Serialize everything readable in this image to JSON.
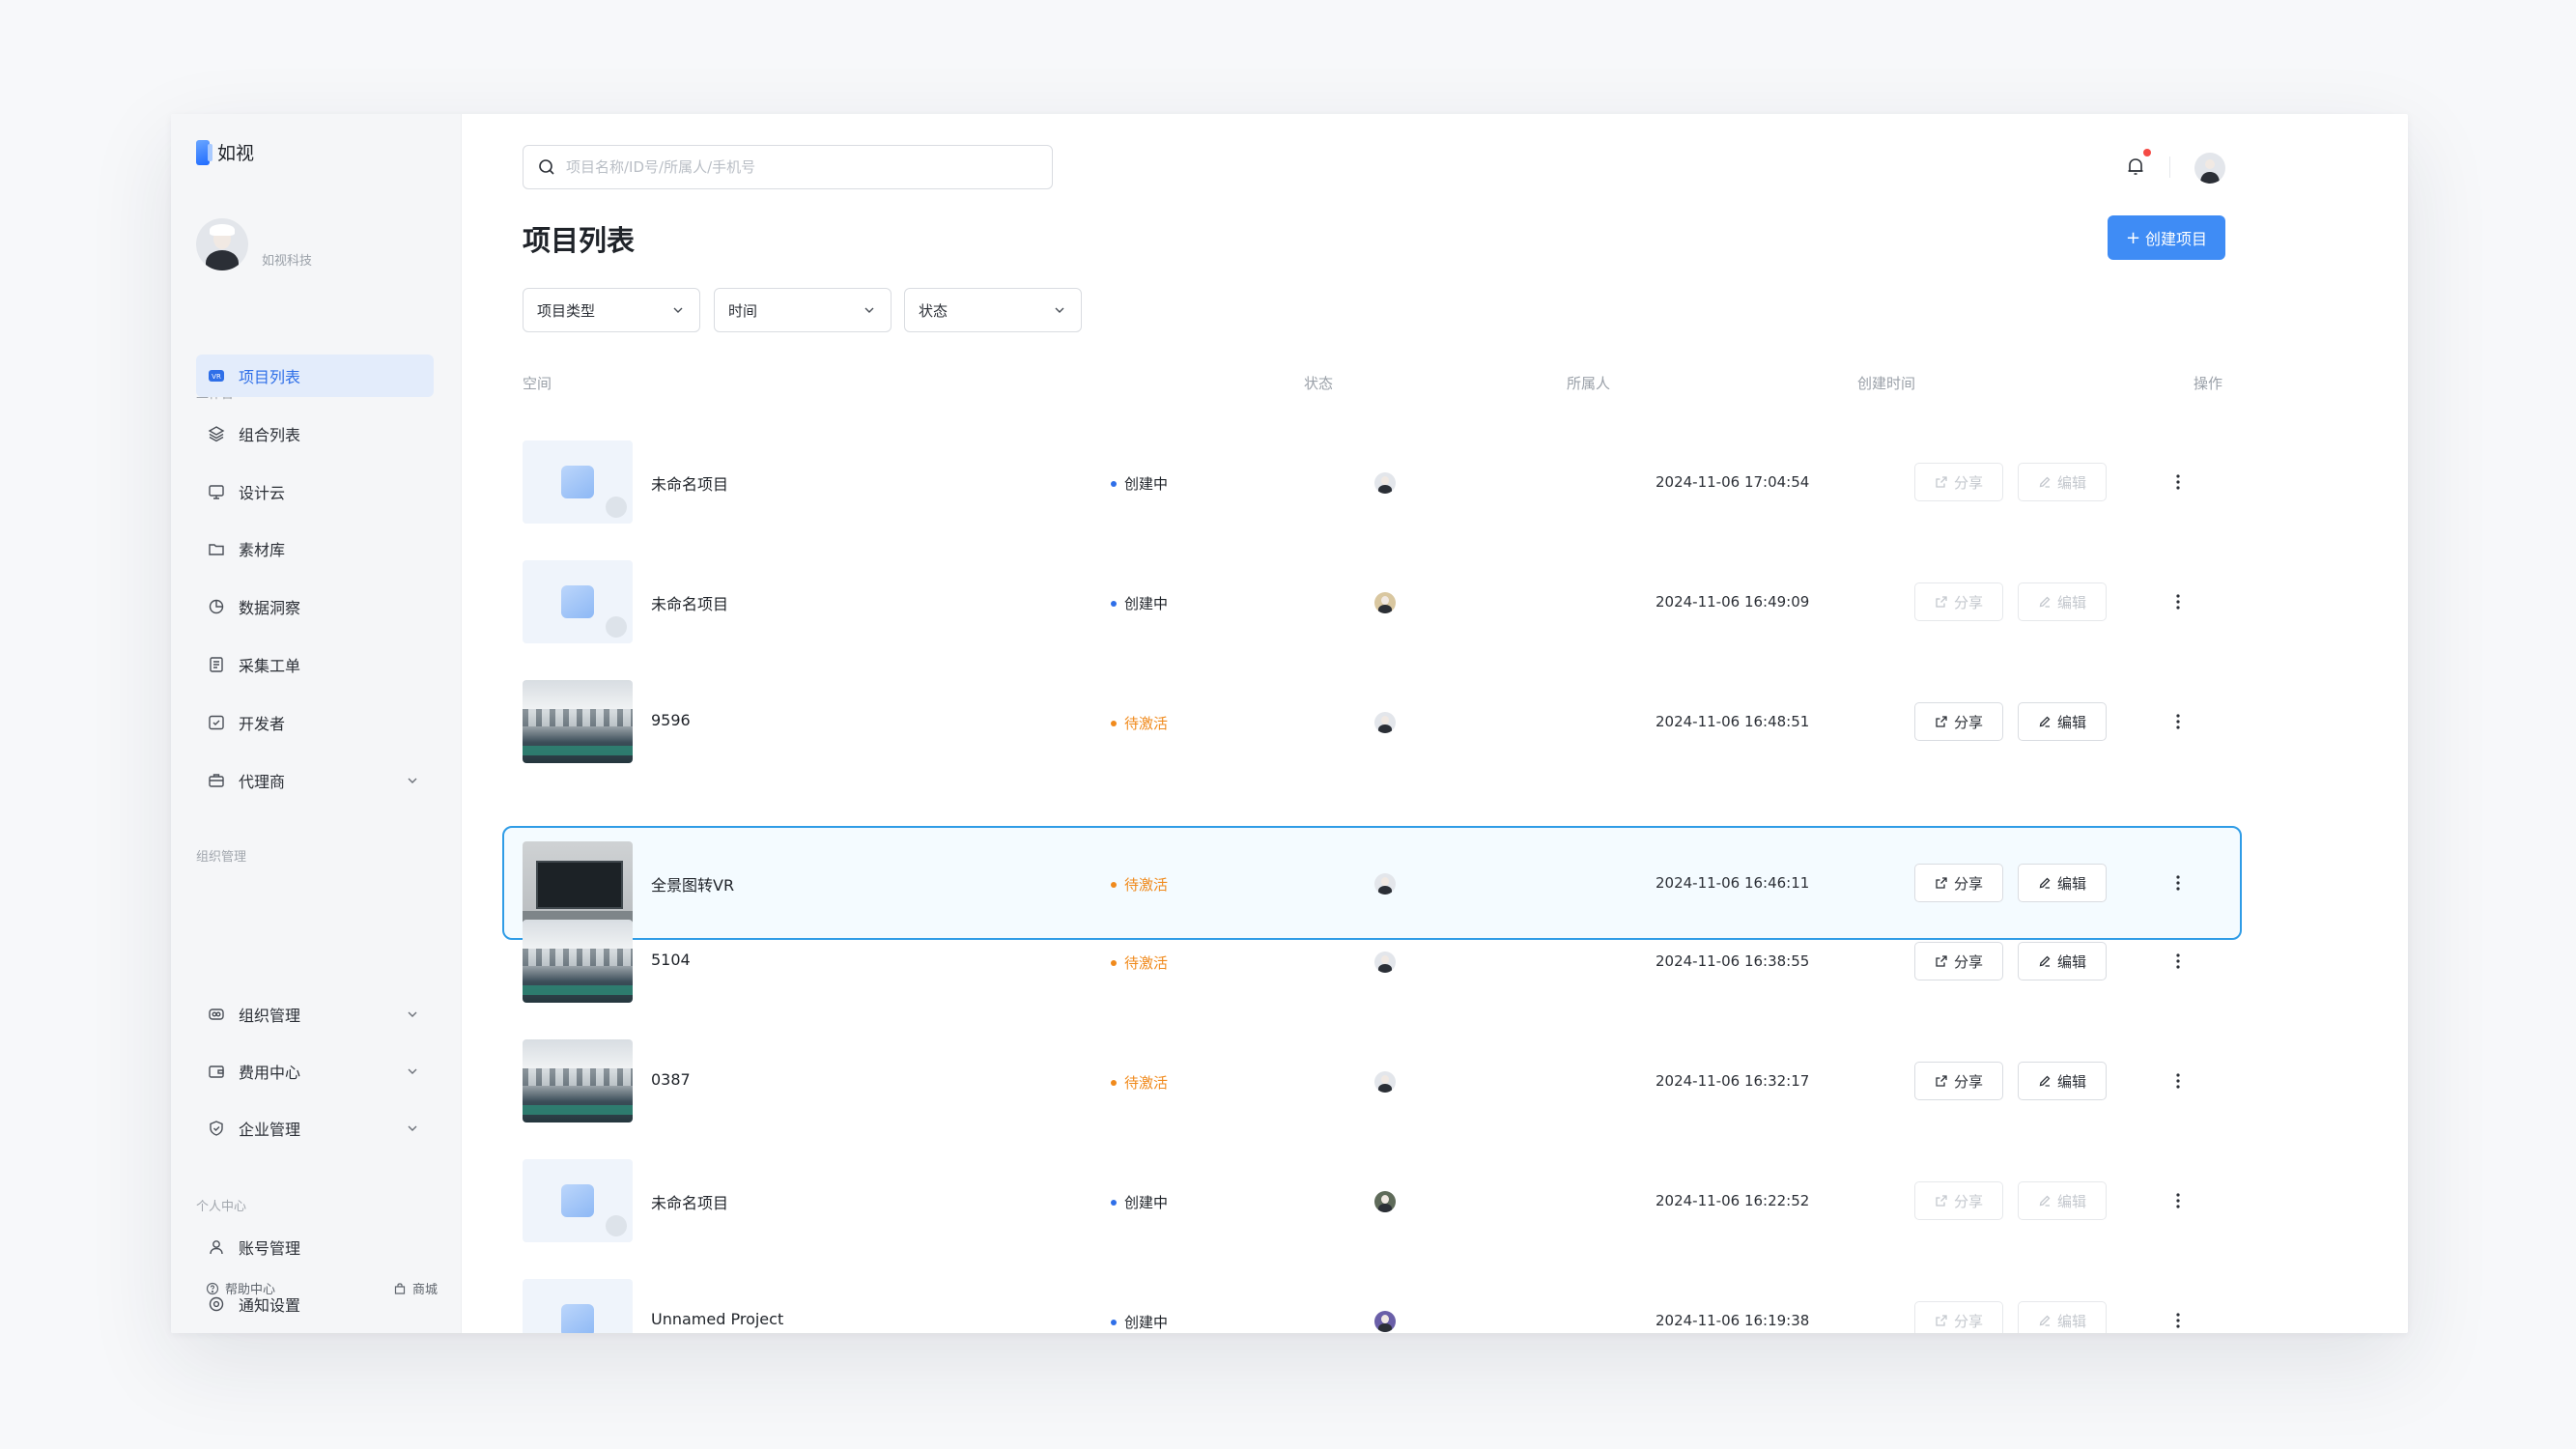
{
  "app": {
    "name": "如视",
    "org": "如视科技"
  },
  "sidebar": {
    "sections": {
      "workbench": "工作台",
      "org": "组织管理",
      "personal": "个人中心"
    },
    "items": [
      {
        "label": "项目列表",
        "icon": "project-list-icon",
        "active": true
      },
      {
        "label": "组合列表",
        "icon": "layers-icon"
      },
      {
        "label": "设计云",
        "icon": "monitor-icon"
      },
      {
        "label": "素材库",
        "icon": "folder-icon"
      },
      {
        "label": "数据洞察",
        "icon": "pie-chart-icon"
      },
      {
        "label": "采集工单",
        "icon": "document-icon"
      },
      {
        "label": "开发者",
        "icon": "developer-icon"
      },
      {
        "label": "代理商",
        "icon": "briefcase-icon",
        "expandable": true
      },
      {
        "label": "组织管理",
        "icon": "org-icon",
        "expandable": true
      },
      {
        "label": "费用中心",
        "icon": "wallet-icon",
        "expandable": true
      },
      {
        "label": "企业管理",
        "icon": "shield-icon",
        "expandable": true
      },
      {
        "label": "账号管理",
        "icon": "user-icon"
      },
      {
        "label": "通知设置",
        "icon": "settings-icon"
      }
    ],
    "footer": {
      "help": "帮助中心",
      "shop": "商城"
    }
  },
  "search": {
    "placeholder": "项目名称/ID号/所属人/手机号",
    "value": ""
  },
  "header": {
    "title": "项目列表",
    "create_label": "创建项目"
  },
  "filters": {
    "type": "项目类型",
    "time": "时间",
    "status": "状态"
  },
  "table": {
    "columns": {
      "space": "空间",
      "status": "状态",
      "owner": "所属人",
      "created": "创建时间",
      "actions": "操作"
    },
    "share_label": "分享",
    "edit_label": "编辑",
    "rows": [
      {
        "name": "未命名项目",
        "status": "创建中",
        "created": "2024-11-06 17:04:54"
      },
      {
        "name": "未命名项目",
        "status": "创建中",
        "created": "2024-11-06 16:49:09"
      },
      {
        "name": "9596",
        "status": "待激活",
        "created": "2024-11-06 16:48:51"
      },
      {
        "name": "全景图转VR",
        "status": "待激活",
        "created": "2024-11-06 16:46:11"
      },
      {
        "name": "5104",
        "status": "待激活",
        "created": "2024-11-06 16:38:55"
      },
      {
        "name": "0387",
        "status": "待激活",
        "created": "2024-11-06 16:32:17"
      },
      {
        "name": "未命名项目",
        "status": "创建中",
        "created": "2024-11-06 16:22:52"
      },
      {
        "name": "Unnamed Project",
        "status": "创建中",
        "created": "2024-11-06 16:19:38"
      }
    ]
  },
  "colors": {
    "accent": "#3f8cf5",
    "active_bg": "#e3ecfb",
    "pending": "#f08a1c",
    "creating_dot": "#2f6fe8",
    "selected_border": "#2f9ce6"
  }
}
